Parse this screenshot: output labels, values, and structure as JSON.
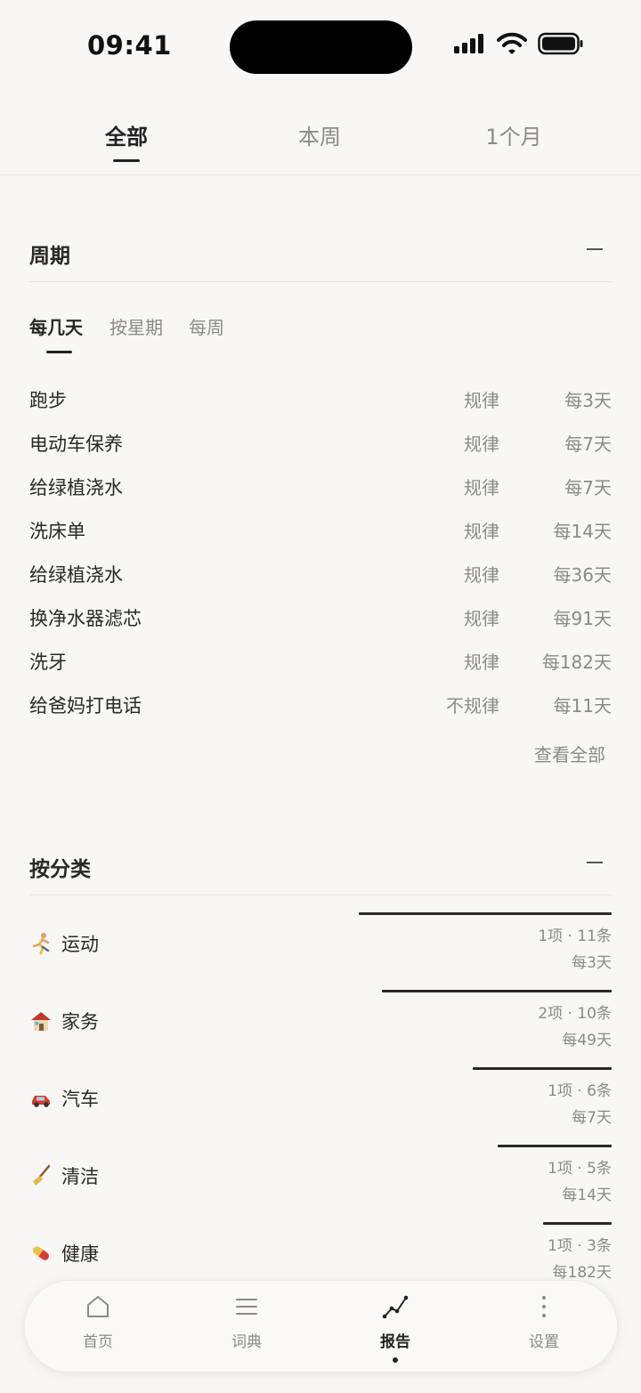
{
  "status_bar": {
    "time": "09:41"
  },
  "top_tabs": [
    {
      "label": "全部",
      "active": true
    },
    {
      "label": "本周",
      "active": false
    },
    {
      "label": "1个月",
      "active": false
    }
  ],
  "cycle_section": {
    "title": "周期",
    "sub_tabs": [
      {
        "label": "每几天",
        "active": true
      },
      {
        "label": "按星期",
        "active": false
      },
      {
        "label": "每周",
        "active": false
      }
    ],
    "rows": [
      {
        "name": "跑步",
        "type": "规律",
        "freq": "每3天"
      },
      {
        "name": "电动车保养",
        "type": "规律",
        "freq": "每7天"
      },
      {
        "name": "给绿植浇水",
        "type": "规律",
        "freq": "每7天"
      },
      {
        "name": "洗床单",
        "type": "规律",
        "freq": "每14天"
      },
      {
        "name": "给绿植浇水",
        "type": "规律",
        "freq": "每36天"
      },
      {
        "name": "换净水器滤芯",
        "type": "规律",
        "freq": "每91天"
      },
      {
        "name": "洗牙",
        "type": "规律",
        "freq": "每182天"
      },
      {
        "name": "给爸妈打电话",
        "type": "不规律",
        "freq": "每11天"
      }
    ],
    "view_all": "查看全部"
  },
  "category_section": {
    "title": "按分类",
    "rows": [
      {
        "icon": "running-icon",
        "name": "运动",
        "stats": "1项 · 11条",
        "freq": "每3天",
        "share": 1.0
      },
      {
        "icon": "house-icon",
        "name": "家务",
        "stats": "2项 · 10条",
        "freq": "每49天",
        "share": 0.91
      },
      {
        "icon": "car-icon",
        "name": "汽车",
        "stats": "1项 · 6条",
        "freq": "每7天",
        "share": 0.55
      },
      {
        "icon": "broom-icon",
        "name": "清洁",
        "stats": "1项 · 5条",
        "freq": "每14天",
        "share": 0.45
      },
      {
        "icon": "pill-icon",
        "name": "健康",
        "stats": "1项 · 3条",
        "freq": "每182天",
        "share": 0.27
      }
    ]
  },
  "bottom_nav": [
    {
      "icon": "home-icon",
      "label": "首页",
      "active": false
    },
    {
      "icon": "list-icon",
      "label": "词典",
      "active": false
    },
    {
      "icon": "chart-icon",
      "label": "报告",
      "active": true
    },
    {
      "icon": "more-icon",
      "label": "设置",
      "active": false
    }
  ]
}
